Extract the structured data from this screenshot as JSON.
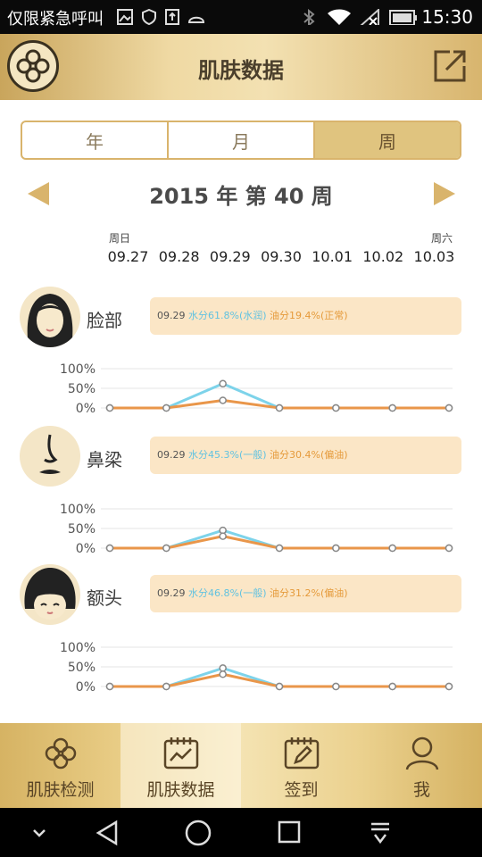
{
  "status_bar": {
    "carrier": "仅限紧急呼叫",
    "time": "15:30"
  },
  "header": {
    "title": "肌肤数据"
  },
  "tabs": [
    {
      "label": "年",
      "active": false
    },
    {
      "label": "月",
      "active": false
    },
    {
      "label": "周",
      "active": true
    }
  ],
  "week": {
    "title": "2015 年 第 40 周",
    "start_weekday": "周日",
    "end_weekday": "周六",
    "dates": [
      "09.27",
      "09.28",
      "09.29",
      "09.30",
      "10.01",
      "10.02",
      "10.03"
    ]
  },
  "sections": [
    {
      "label": "脸部",
      "info_date": "09.29",
      "water_text": "水分61.8%(水润)",
      "oil_text": "油分19.4%(正常)"
    },
    {
      "label": "鼻梁",
      "info_date": "09.29",
      "water_text": "水分45.3%(一般)",
      "oil_text": "油分30.4%(偏油)"
    },
    {
      "label": "额头",
      "info_date": "09.29",
      "water_text": "水分46.8%(一般)",
      "oil_text": "油分31.2%(偏油)"
    }
  ],
  "chart_colors": {
    "water": "#7dd3ea",
    "oil": "#e9964a"
  },
  "chart_data": [
    {
      "type": "line",
      "title": "",
      "categories": [
        "09.27",
        "09.28",
        "09.29",
        "09.30",
        "10.01",
        "10.02",
        "10.03"
      ],
      "series": [
        {
          "values": [
            0,
            0,
            61.8,
            0,
            0,
            0,
            0
          ]
        },
        {
          "values": [
            0,
            0,
            19.4,
            0,
            0,
            0,
            0
          ]
        }
      ],
      "yticks": [
        "100%",
        "50%",
        "0%"
      ],
      "ylim": [
        0,
        100
      ]
    },
    {
      "type": "line",
      "title": "",
      "categories": [
        "09.27",
        "09.28",
        "09.29",
        "09.30",
        "10.01",
        "10.02",
        "10.03"
      ],
      "series": [
        {
          "values": [
            0,
            0,
            45.3,
            0,
            0,
            0,
            0
          ]
        },
        {
          "values": [
            0,
            0,
            30.4,
            0,
            0,
            0,
            0
          ]
        }
      ],
      "yticks": [
        "100%",
        "50%",
        "0%"
      ],
      "ylim": [
        0,
        100
      ]
    },
    {
      "type": "line",
      "title": "",
      "categories": [
        "09.27",
        "09.28",
        "09.29",
        "09.30",
        "10.01",
        "10.02",
        "10.03"
      ],
      "series": [
        {
          "values": [
            0,
            0,
            46.8,
            0,
            0,
            0,
            0
          ]
        },
        {
          "values": [
            0,
            0,
            31.2,
            0,
            0,
            0,
            0
          ]
        }
      ],
      "yticks": [
        "100%",
        "50%",
        "0%"
      ],
      "ylim": [
        0,
        100
      ]
    }
  ],
  "bottom_nav": [
    {
      "label": "肌肤检测",
      "icon": "flower-icon",
      "active": false
    },
    {
      "label": "肌肤数据",
      "icon": "chart-calendar-icon",
      "active": true
    },
    {
      "label": "签到",
      "icon": "sign-in-calendar-icon",
      "active": false
    },
    {
      "label": "我",
      "icon": "user-icon",
      "active": false
    }
  ]
}
